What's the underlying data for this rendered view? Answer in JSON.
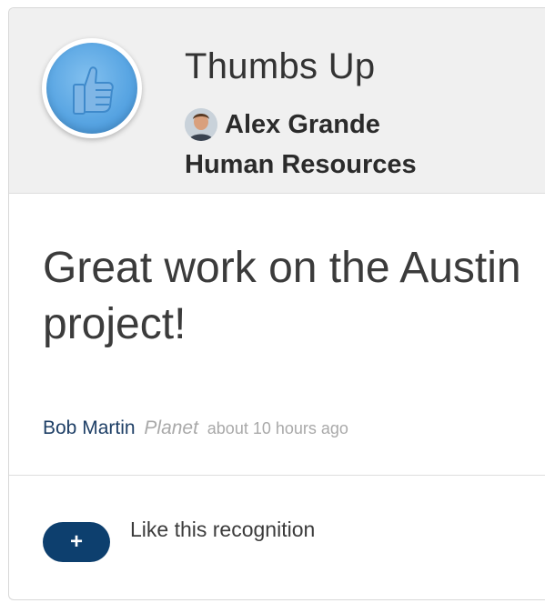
{
  "award": {
    "title": "Thumbs Up",
    "badge_icon": "thumbs-up-icon",
    "badge_color": "#5aa6e3"
  },
  "recipient": {
    "name": "Alex Grande",
    "department": "Human Resources"
  },
  "message": "Great work on the Austin project!",
  "meta": {
    "author": "Bob Martin",
    "planet": "Planet",
    "time": "about 10 hours ago"
  },
  "like": {
    "button_label": "+",
    "label": "Like this recognition",
    "button_color": "#0d3f6e"
  }
}
